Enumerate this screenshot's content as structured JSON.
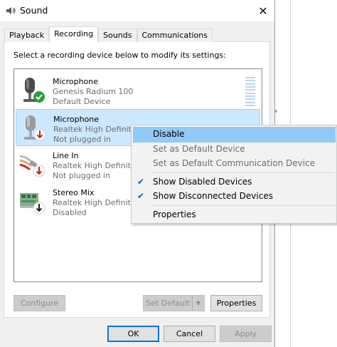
{
  "window": {
    "title": "Sound",
    "close_glyph": "✕"
  },
  "tabs": [
    {
      "label": "Playback",
      "active": false
    },
    {
      "label": "Recording",
      "active": true
    },
    {
      "label": "Sounds",
      "active": false
    },
    {
      "label": "Communications",
      "active": false
    }
  ],
  "instruction": "Select a recording device below to modify its settings:",
  "devices": [
    {
      "name": "Microphone",
      "description": "Genesis Radium 100",
      "status": "Default Device",
      "icon": "microphone-icon",
      "badge": "default-check-badge"
    },
    {
      "name": "Microphone",
      "description": "Realtek High Definition",
      "status": "Not plugged in",
      "icon": "microphone-icon",
      "badge": "unplugged-badge"
    },
    {
      "name": "Line In",
      "description": "Realtek High Definition",
      "status": "Not plugged in",
      "icon": "line-in-cable-icon",
      "badge": "unplugged-badge"
    },
    {
      "name": "Stereo Mix",
      "description": "Realtek High Definition",
      "status": "Disabled",
      "icon": "sound-card-icon",
      "badge": "disabled-badge"
    }
  ],
  "buttons": {
    "configure": "Configure",
    "set_default": "Set Default",
    "properties": "Properties",
    "ok": "OK",
    "cancel": "Cancel",
    "apply": "Apply"
  },
  "context_menu": {
    "items": [
      {
        "label": "Disable",
        "state": "highlighted"
      },
      {
        "label": "Set as Default Device",
        "state": "disabled"
      },
      {
        "label": "Set as Default Communication Device",
        "state": "disabled"
      },
      {
        "label": "Show Disabled Devices",
        "checked": true
      },
      {
        "label": "Show Disconnected Devices",
        "checked": true
      },
      {
        "label": "Properties",
        "state": "normal"
      }
    ],
    "check_glyph": "✔"
  },
  "colors": {
    "selection": "#cce8ff",
    "menu_highlight": "#91c9f7",
    "default_badge": "#2e9d3a",
    "unplugged_badge": "#d01c1c"
  }
}
